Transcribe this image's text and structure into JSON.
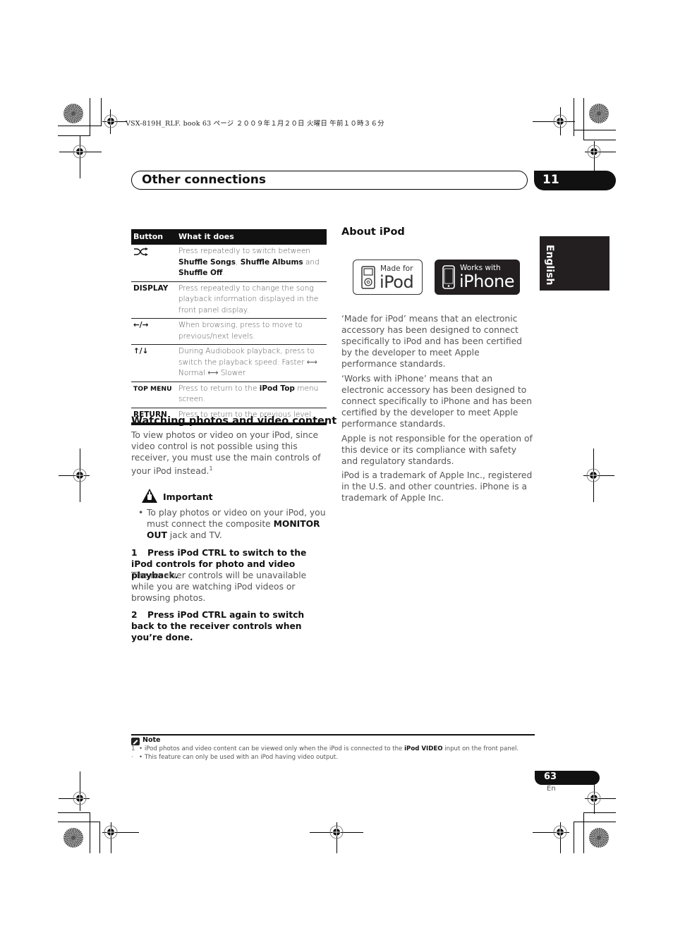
{
  "print_slug": "VSX-819H_RLF. book   63 ページ   ２００９年１月２０日   火曜日   午前１０時３６分",
  "header": {
    "title": "Other connections",
    "chapter_number": "11"
  },
  "language_tab": "English",
  "button_table": {
    "columns": [
      "Button",
      "What it does"
    ],
    "rows": [
      {
        "button_icon": "shuffle-icon",
        "button": "",
        "desc_parts": [
          "Press repeatedly to switch between ",
          "Shuffle Songs",
          ", ",
          "Shuffle Albums",
          " and ",
          "Shuffle Off",
          "."
        ]
      },
      {
        "button": "DISPLAY",
        "desc": "Press repeatedly to change the song playback information displayed in the front panel display."
      },
      {
        "button": "←/→",
        "button_icon": "left-right-arrows-icon",
        "desc": "When browsing, press to move to previous/next levels."
      },
      {
        "button": "↑/↓",
        "button_icon": "up-down-arrows-icon",
        "desc": "During Audiobook playback, press to switch the playback speed: Faster ⟷ Normal ⟷ Slower"
      },
      {
        "button": "TOP MENU",
        "desc_parts": [
          "Press to return to the ",
          "iPod Top",
          " menu screen."
        ]
      },
      {
        "button": "RETURN",
        "desc": "Press to return to the previous level."
      }
    ]
  },
  "watching_section": {
    "heading": "Watching photos and video content",
    "intro": "To view photos or video on your iPod, since video control is not possible using this receiver, you must use the main controls of your iPod instead.",
    "footnote_ref": "1",
    "important_label": "Important",
    "important_bullet_parts": [
      "To play photos or video on your iPod, you must connect the composite ",
      "MONITOR OUT",
      " jack and TV."
    ],
    "steps": [
      {
        "number": "1",
        "title": "Press iPod CTRL to switch to the iPod controls for photo and video playback.",
        "body": "The receiver controls will be unavailable while you are watching iPod videos or browsing photos."
      },
      {
        "number": "2",
        "title": "Press iPod CTRL again to switch back to the receiver controls when you’re done.",
        "body": ""
      }
    ]
  },
  "about_ipod": {
    "heading": "About iPod",
    "logos": [
      {
        "small": "Made for",
        "big": "iPod",
        "icon": "ipod-device-icon"
      },
      {
        "small": "Works with",
        "big": "iPhone",
        "icon": "iphone-device-icon"
      }
    ],
    "paragraphs": [
      "‘Made for iPod’ means that an electronic accessory has been designed to connect specifically to iPod and has been certified by the developer to meet Apple performance standards.",
      "‘Works with iPhone’ means that an electronic accessory has been designed to connect specifically to iPhone and has been certified by the developer to meet Apple performance standards.",
      "Apple is not responsible for the operation of this device or its compliance with safety and regulatory standards.",
      "iPod is a trademark of Apple Inc., registered in the U.S. and other countries. iPhone is a trademark of Apple Inc."
    ]
  },
  "note": {
    "label": "Note",
    "items": [
      {
        "number": "1",
        "parts": [
          "iPod photos and video content can be viewed only when the iPod is connected to the ",
          "iPod VIDEO",
          " input on the front panel."
        ]
      },
      {
        "number": "·",
        "parts": [
          "This feature can only be used with an iPod having video output."
        ]
      }
    ]
  },
  "footer": {
    "page_number": "63",
    "page_lang": "En"
  }
}
